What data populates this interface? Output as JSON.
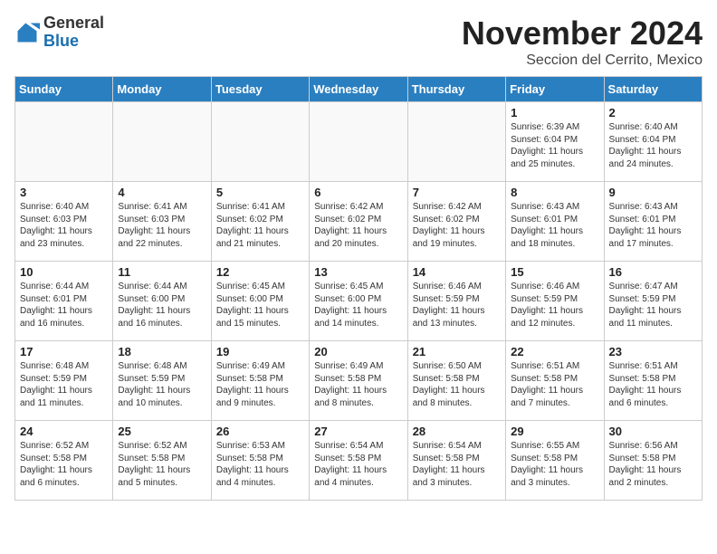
{
  "header": {
    "logo_general": "General",
    "logo_blue": "Blue",
    "month_title": "November 2024",
    "location": "Seccion del Cerrito, Mexico"
  },
  "weekdays": [
    "Sunday",
    "Monday",
    "Tuesday",
    "Wednesday",
    "Thursday",
    "Friday",
    "Saturday"
  ],
  "weeks": [
    [
      {
        "day": "",
        "detail": ""
      },
      {
        "day": "",
        "detail": ""
      },
      {
        "day": "",
        "detail": ""
      },
      {
        "day": "",
        "detail": ""
      },
      {
        "day": "",
        "detail": ""
      },
      {
        "day": "1",
        "detail": "Sunrise: 6:39 AM\nSunset: 6:04 PM\nDaylight: 11 hours and 25 minutes."
      },
      {
        "day": "2",
        "detail": "Sunrise: 6:40 AM\nSunset: 6:04 PM\nDaylight: 11 hours and 24 minutes."
      }
    ],
    [
      {
        "day": "3",
        "detail": "Sunrise: 6:40 AM\nSunset: 6:03 PM\nDaylight: 11 hours and 23 minutes."
      },
      {
        "day": "4",
        "detail": "Sunrise: 6:41 AM\nSunset: 6:03 PM\nDaylight: 11 hours and 22 minutes."
      },
      {
        "day": "5",
        "detail": "Sunrise: 6:41 AM\nSunset: 6:02 PM\nDaylight: 11 hours and 21 minutes."
      },
      {
        "day": "6",
        "detail": "Sunrise: 6:42 AM\nSunset: 6:02 PM\nDaylight: 11 hours and 20 minutes."
      },
      {
        "day": "7",
        "detail": "Sunrise: 6:42 AM\nSunset: 6:02 PM\nDaylight: 11 hours and 19 minutes."
      },
      {
        "day": "8",
        "detail": "Sunrise: 6:43 AM\nSunset: 6:01 PM\nDaylight: 11 hours and 18 minutes."
      },
      {
        "day": "9",
        "detail": "Sunrise: 6:43 AM\nSunset: 6:01 PM\nDaylight: 11 hours and 17 minutes."
      }
    ],
    [
      {
        "day": "10",
        "detail": "Sunrise: 6:44 AM\nSunset: 6:01 PM\nDaylight: 11 hours and 16 minutes."
      },
      {
        "day": "11",
        "detail": "Sunrise: 6:44 AM\nSunset: 6:00 PM\nDaylight: 11 hours and 16 minutes."
      },
      {
        "day": "12",
        "detail": "Sunrise: 6:45 AM\nSunset: 6:00 PM\nDaylight: 11 hours and 15 minutes."
      },
      {
        "day": "13",
        "detail": "Sunrise: 6:45 AM\nSunset: 6:00 PM\nDaylight: 11 hours and 14 minutes."
      },
      {
        "day": "14",
        "detail": "Sunrise: 6:46 AM\nSunset: 5:59 PM\nDaylight: 11 hours and 13 minutes."
      },
      {
        "day": "15",
        "detail": "Sunrise: 6:46 AM\nSunset: 5:59 PM\nDaylight: 11 hours and 12 minutes."
      },
      {
        "day": "16",
        "detail": "Sunrise: 6:47 AM\nSunset: 5:59 PM\nDaylight: 11 hours and 11 minutes."
      }
    ],
    [
      {
        "day": "17",
        "detail": "Sunrise: 6:48 AM\nSunset: 5:59 PM\nDaylight: 11 hours and 11 minutes."
      },
      {
        "day": "18",
        "detail": "Sunrise: 6:48 AM\nSunset: 5:59 PM\nDaylight: 11 hours and 10 minutes."
      },
      {
        "day": "19",
        "detail": "Sunrise: 6:49 AM\nSunset: 5:58 PM\nDaylight: 11 hours and 9 minutes."
      },
      {
        "day": "20",
        "detail": "Sunrise: 6:49 AM\nSunset: 5:58 PM\nDaylight: 11 hours and 8 minutes."
      },
      {
        "day": "21",
        "detail": "Sunrise: 6:50 AM\nSunset: 5:58 PM\nDaylight: 11 hours and 8 minutes."
      },
      {
        "day": "22",
        "detail": "Sunrise: 6:51 AM\nSunset: 5:58 PM\nDaylight: 11 hours and 7 minutes."
      },
      {
        "day": "23",
        "detail": "Sunrise: 6:51 AM\nSunset: 5:58 PM\nDaylight: 11 hours and 6 minutes."
      }
    ],
    [
      {
        "day": "24",
        "detail": "Sunrise: 6:52 AM\nSunset: 5:58 PM\nDaylight: 11 hours and 6 minutes."
      },
      {
        "day": "25",
        "detail": "Sunrise: 6:52 AM\nSunset: 5:58 PM\nDaylight: 11 hours and 5 minutes."
      },
      {
        "day": "26",
        "detail": "Sunrise: 6:53 AM\nSunset: 5:58 PM\nDaylight: 11 hours and 4 minutes."
      },
      {
        "day": "27",
        "detail": "Sunrise: 6:54 AM\nSunset: 5:58 PM\nDaylight: 11 hours and 4 minutes."
      },
      {
        "day": "28",
        "detail": "Sunrise: 6:54 AM\nSunset: 5:58 PM\nDaylight: 11 hours and 3 minutes."
      },
      {
        "day": "29",
        "detail": "Sunrise: 6:55 AM\nSunset: 5:58 PM\nDaylight: 11 hours and 3 minutes."
      },
      {
        "day": "30",
        "detail": "Sunrise: 6:56 AM\nSunset: 5:58 PM\nDaylight: 11 hours and 2 minutes."
      }
    ]
  ]
}
